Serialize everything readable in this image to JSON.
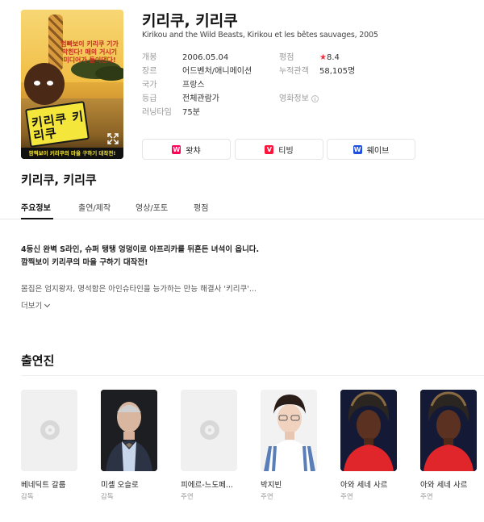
{
  "movie": {
    "title": "키리쿠, 키리쿠",
    "subtitle": "Kirikou and the Wild Beasts, Kirikou et les bêtes sauvages, 2005",
    "poster": {
      "top_text": "엄빠보이 키리쿠 기가 막힌다! 매의 거시기 미디어가 들이댄다!",
      "sign_text": "키리쿠 키리쿠",
      "bottom_text": "깜찍보이 키리쿠의 마을 구하기 대작전!"
    }
  },
  "info": {
    "release_label": "개봉",
    "release_value": "2006.05.04",
    "genre_label": "장르",
    "genre_value": "어드벤처/애니메이션",
    "country_label": "국가",
    "country_value": "프랑스",
    "rating_label": "등급",
    "rating_value": "전체관람가",
    "runtime_label": "러닝타임",
    "runtime_value": "75분",
    "score_label": "평점",
    "score_value": "8.4",
    "audience_label": "누적관객",
    "audience_value": "58,105명",
    "promo_label": "영화정보"
  },
  "ott": [
    {
      "label": "왓챠",
      "color": "#ff0558",
      "mark": "W"
    },
    {
      "label": "티빙",
      "color": "#ff153c",
      "mark": "V"
    },
    {
      "label": "웨이브",
      "color": "#1f4fe0",
      "mark": "W"
    }
  ],
  "subhead": "키리쿠, 키리쿠",
  "tabs": [
    "주요정보",
    "출연/제작",
    "영상/포토",
    "평점"
  ],
  "description": {
    "line1": "4등신 완벽 S라인, 슈퍼 탱탱 엉덩이로 아프리카를 뒤흔든 녀석이 옵니다.",
    "line2": "깜찍보이 키리쿠의 마을 구하기 대작전!",
    "summary": "몸집은 엄지왕자, 명석함은 아인슈타인을 능가하는 만능 해결사 '키리쿠'...",
    "more": "더보기"
  },
  "cast_title": "출연진",
  "cast": [
    {
      "name": "베네딕트 갈룹",
      "role": "감독",
      "photo": "placeholder"
    },
    {
      "name": "미셸 오슬로",
      "role": "감독",
      "photo": "elderly-man"
    },
    {
      "name": "피에르-느도페...",
      "role": "주연",
      "photo": "placeholder"
    },
    {
      "name": "박지빈",
      "role": "주연",
      "photo": "young-man"
    },
    {
      "name": "아와 세네 사르",
      "role": "주연",
      "photo": "woman"
    },
    {
      "name": "아와 세네 사르",
      "role": "주연",
      "photo": "woman"
    }
  ]
}
